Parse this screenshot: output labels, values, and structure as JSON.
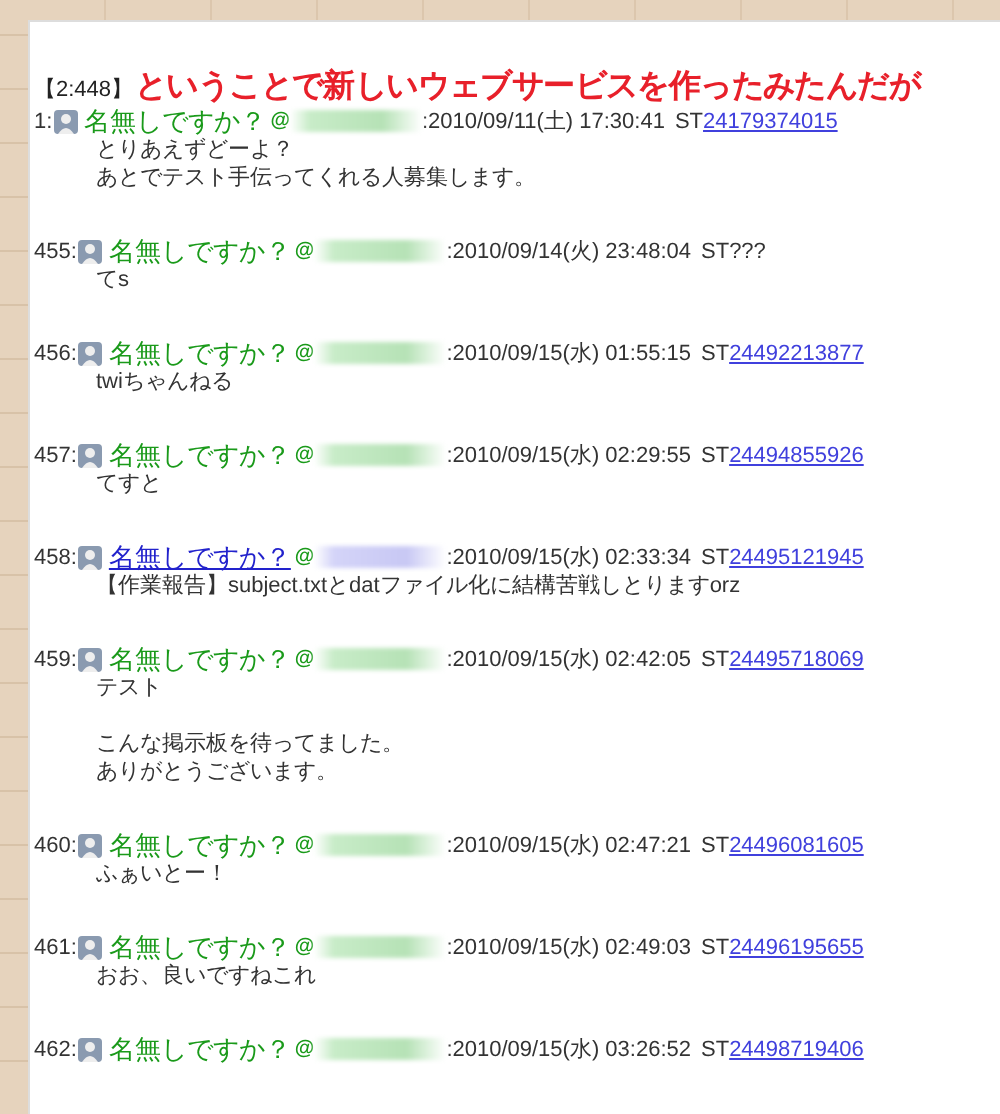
{
  "thread": {
    "tag": "【2:448】",
    "title": "ということで新しいウェブサービスを作ったみたんだが"
  },
  "posts": [
    {
      "number": "1:",
      "name": "名無しですか？",
      "name_linked": false,
      "at": "@",
      "date": ":2010/09/11(土) 17:30:41",
      "st_prefix": "ST",
      "st": "24179374015",
      "st_linked": true,
      "paragraphs": [
        [
          "とりあえずどーよ？",
          "あとでテスト手伝ってくれる人募集します。"
        ]
      ]
    },
    {
      "number": "455:",
      "name": "名無しですか？",
      "name_linked": false,
      "at": "@",
      "date": ":2010/09/14(火) 23:48:04",
      "st_prefix": "ST",
      "st": "???",
      "st_linked": false,
      "paragraphs": [
        [
          "てs"
        ]
      ]
    },
    {
      "number": "456:",
      "name": "名無しですか？",
      "name_linked": false,
      "at": "@",
      "date": ":2010/09/15(水) 01:55:15",
      "st_prefix": "ST",
      "st": "24492213877",
      "st_linked": true,
      "paragraphs": [
        [
          "twiちゃんねる"
        ]
      ]
    },
    {
      "number": "457:",
      "name": "名無しですか？",
      "name_linked": false,
      "at": "@",
      "date": ":2010/09/15(水) 02:29:55",
      "st_prefix": "ST",
      "st": "24494855926",
      "st_linked": true,
      "paragraphs": [
        [
          "てすと"
        ]
      ]
    },
    {
      "number": "458:",
      "name": "名無しですか？",
      "name_linked": true,
      "at": "@",
      "date": ":2010/09/15(水) 02:33:34",
      "st_prefix": "ST",
      "st": "24495121945",
      "st_linked": true,
      "paragraphs": [
        [
          "【作業報告】subject.txtとdatファイル化に結構苦戦しとりますorz"
        ]
      ]
    },
    {
      "number": "459:",
      "name": "名無しですか？",
      "name_linked": false,
      "at": "@",
      "date": ":2010/09/15(水) 02:42:05",
      "st_prefix": "ST",
      "st": "24495718069",
      "st_linked": true,
      "paragraphs": [
        [
          "テスト"
        ],
        [
          "こんな掲示板を待ってました。",
          "ありがとうございます。"
        ]
      ]
    },
    {
      "number": "460:",
      "name": "名無しですか？",
      "name_linked": false,
      "at": "@",
      "date": ":2010/09/15(水) 02:47:21",
      "st_prefix": "ST",
      "st": "24496081605",
      "st_linked": true,
      "paragraphs": [
        [
          "ふぁいとー！"
        ]
      ]
    },
    {
      "number": "461:",
      "name": "名無しですか？",
      "name_linked": false,
      "at": "@",
      "date": ":2010/09/15(水) 02:49:03",
      "st_prefix": "ST",
      "st": "24496195655",
      "st_linked": true,
      "paragraphs": [
        [
          "おお、良いですねこれ"
        ]
      ]
    },
    {
      "number": "462:",
      "name": "名無しですか？",
      "name_linked": false,
      "at": "@",
      "date": ":2010/09/15(水) 03:26:52",
      "st_prefix": "ST",
      "st": "24498719406",
      "st_linked": true
    }
  ]
}
